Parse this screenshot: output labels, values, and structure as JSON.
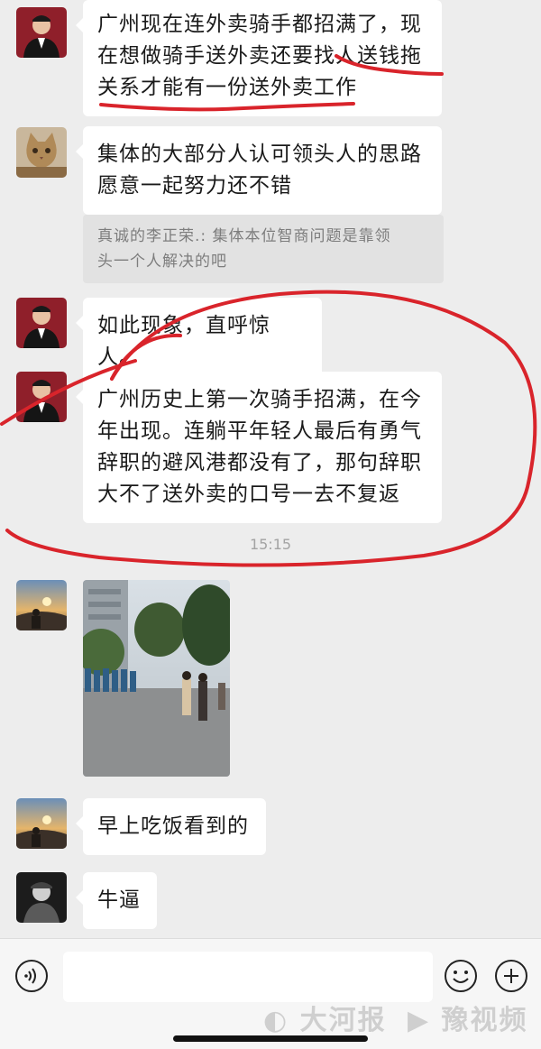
{
  "messages": [
    {
      "text_lines": [
        "广州现在连外卖骑手都招满了，现",
        "在想做骑手送外卖还要找人送钱拖",
        "关系才能有一份送外卖工作"
      ]
    },
    {
      "text_lines": [
        "集体的大部分人认可领头人的思路",
        "愿意一起努力还不错"
      ],
      "quote_lines": [
        "真诚的李正荣.: 集体本位智商问题是靠领",
        "头一个人解决的吧"
      ]
    },
    {
      "text_lines": [
        "如此现象，直呼惊人。"
      ]
    },
    {
      "text_lines": [
        "广州历史上第一次骑手招满，在今",
        "年出现。连躺平年轻人最后有勇气",
        "辞职的避风港都没有了，那句辞职",
        "大不了送外卖的口号一去不复返"
      ]
    },
    {
      "text_lines": [
        "早上吃饭看到的"
      ]
    },
    {
      "text_lines": [
        "牛逼"
      ]
    }
  ],
  "timestamp": "15:15",
  "input_bar": {
    "voice_icon": "voice-icon",
    "emoji_icon": "emoji-icon",
    "plus_icon": "plus-icon"
  },
  "watermarks": {
    "left": "大河报",
    "right": "豫视频"
  },
  "colors": {
    "background": "#ededed",
    "bubble": "#ffffff",
    "annotation_red": "#d9242b"
  }
}
